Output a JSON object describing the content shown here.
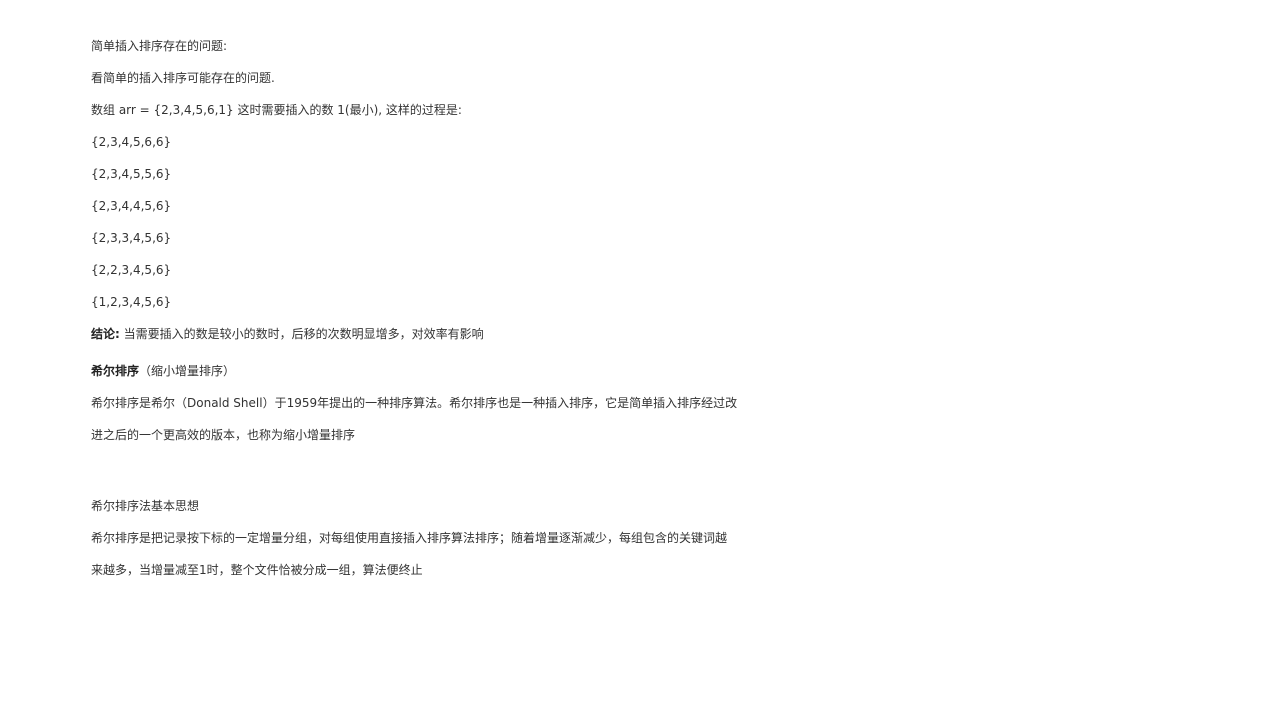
{
  "section1": {
    "heading": "简单插入排序存在的问题:",
    "intro": "看简单的插入排序可能存在的问题.",
    "example": "数组 arr = {2,3,4,5,6,1} 这时需要插入的数  1(最小), 这样的过程是:",
    "steps": [
      "{2,3,4,5,6,6}",
      "{2,3,4,5,5,6}",
      "{2,3,4,4,5,6}",
      "{2,3,3,4,5,6}",
      "{2,2,3,4,5,6}",
      "{1,2,3,4,5,6}"
    ],
    "conclusion_label": "结论:",
    "conclusion_text": " 当需要插入的数是较小的数时，后移的次数明显增多，对效率有影响"
  },
  "section2": {
    "title_bold": "希尔排序",
    "title_rest": "（缩小增量排序）",
    "para_line1": "希尔排序是希尔（Donald   Shell）于1959年提出的一种排序算法。希尔排序也是一种插入排序，它是简单插入排序经过改",
    "para_line2": "进之后的一个更高效的版本，也称为缩小增量排序"
  },
  "section3": {
    "title": "希尔排序法基本思想",
    "para_line1": "希尔排序是把记录按下标的一定增量分组，对每组使用直接插入排序算法排序；随着增量逐渐减少，每组包含的关键词越",
    "para_line2": "来越多，当增量减至1时，整个文件恰被分成一组，算法便终止"
  }
}
